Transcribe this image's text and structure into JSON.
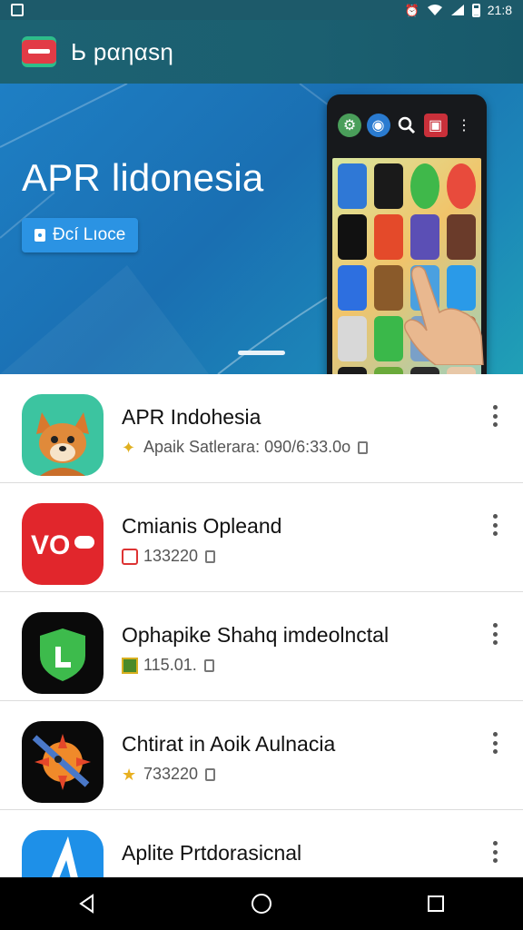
{
  "status_bar": {
    "time": "21:8",
    "icons": [
      "notification-icon",
      "alarm-icon",
      "wifi-icon",
      "signal-icon",
      "battery-icon"
    ]
  },
  "app_bar": {
    "title": "Ь pαηαsη",
    "actions": [
      "settings-icon",
      "search-icon",
      "shop-icon",
      "more-icon"
    ]
  },
  "hero": {
    "title": "APR lidonesia",
    "button_label": "Ðcí Lıoce",
    "page_indicator": "1"
  },
  "colors": {
    "accent": "#2b93e3",
    "appbar": "#1b5f70",
    "hero": "#1a6fb2"
  },
  "list": {
    "items": [
      {
        "title": "APR Indohesia",
        "subtitle": "Apaik Satlerara: 090/6:33.0o",
        "icon": "fox-app-icon",
        "badge_icon": "sparkle-icon"
      },
      {
        "title": "Cmianis Opleand",
        "subtitle": "133220",
        "icon": "vo-app-icon",
        "badge_icon": "gift-icon"
      },
      {
        "title": "Ophapike Shahq imdeolnctal",
        "subtitle": "115.01.",
        "icon": "shield-app-icon",
        "badge_icon": "image-icon"
      },
      {
        "title": "Chtirat in Aoik Aulnacia",
        "subtitle": "733220",
        "icon": "rocket-app-icon",
        "badge_icon": "star-icon"
      },
      {
        "title": "Aplite Prtdorasicnal",
        "subtitle": "",
        "icon": "arrow-app-icon",
        "badge_icon": ""
      }
    ]
  },
  "nav": {
    "buttons": [
      "back-icon",
      "home-icon",
      "recents-icon"
    ]
  }
}
